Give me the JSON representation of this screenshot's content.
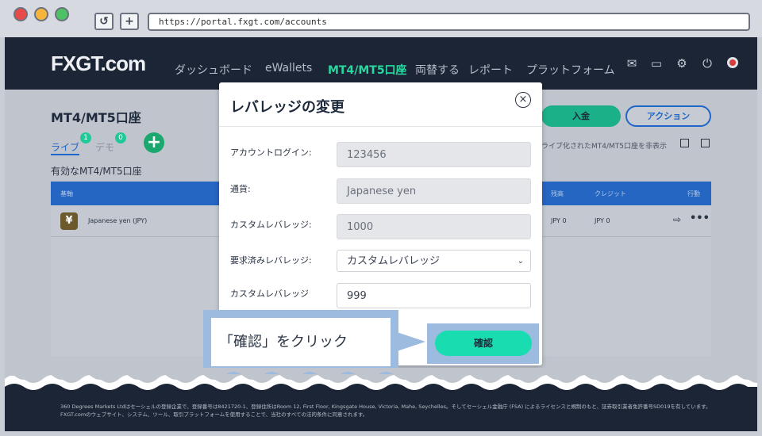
{
  "browser": {
    "url": "https://portal.fxgt.com/accounts",
    "reload_icon": "↺",
    "newtab_icon": "+"
  },
  "header": {
    "logo": "FXGT.com",
    "nav": [
      "ダッシュボード",
      "eWallets",
      "MT4/MT5口座",
      "両替する",
      "レポート",
      "プラットフォーム"
    ],
    "active_index": 2,
    "icons": [
      "mail-icon",
      "ticket-icon",
      "gear-icon",
      "power-icon",
      "status-icon"
    ]
  },
  "page": {
    "title": "MT4/MT5口座",
    "tab_live": "ライブ",
    "tab_live_count": "1",
    "tab_demo": "デモ",
    "tab_demo_count": "0",
    "add_label": "+",
    "active_accounts": "有効なMT4/MT5口座",
    "deposit": "入金",
    "action": "アクション",
    "hide_text": "ライブ化されたMT4/MT5口座を非表示"
  },
  "table": {
    "headers": [
      "基軸",
      "残高",
      "クレジット",
      "行動"
    ],
    "rows": [
      {
        "currency_icon": "¥",
        "currency": "Japanese yen (JPY)",
        "balance": "JPY 0",
        "credit": "JPY 0"
      }
    ]
  },
  "modal": {
    "title": "レバレッジの変更",
    "close_icon": "×",
    "fields": [
      {
        "label": "アカウントログイン:",
        "value": "123456"
      },
      {
        "label": "通貨:",
        "value": "Japanese yen"
      },
      {
        "label": "カスタムレバレッジ:",
        "value": "1000"
      },
      {
        "label": "要求済みレバレッジ:",
        "value": "カスタムレバレッジ"
      },
      {
        "label": "カスタムレバレッジ",
        "value": "999"
      }
    ],
    "confirm": "確認"
  },
  "callout": {
    "text": "「確認」をクリック"
  },
  "footer": {
    "text": "360 Degrees Markets Ltdはセーシェルの登録企業で、登録番号は8421720-1、登録住所はRoom 12, First Floor, Kingsgate House, Victoria, Mahe, Seychelles。そしてセーシェル金融庁 (FSA) によるライセンスと規制のもと、証券取引業者免許番号SD019を有しています。FXGT.comのウェブサイト、システム、ツール、取引プラットフォームを使用することで、当社のすべての法的条件に同意されます。"
  }
}
